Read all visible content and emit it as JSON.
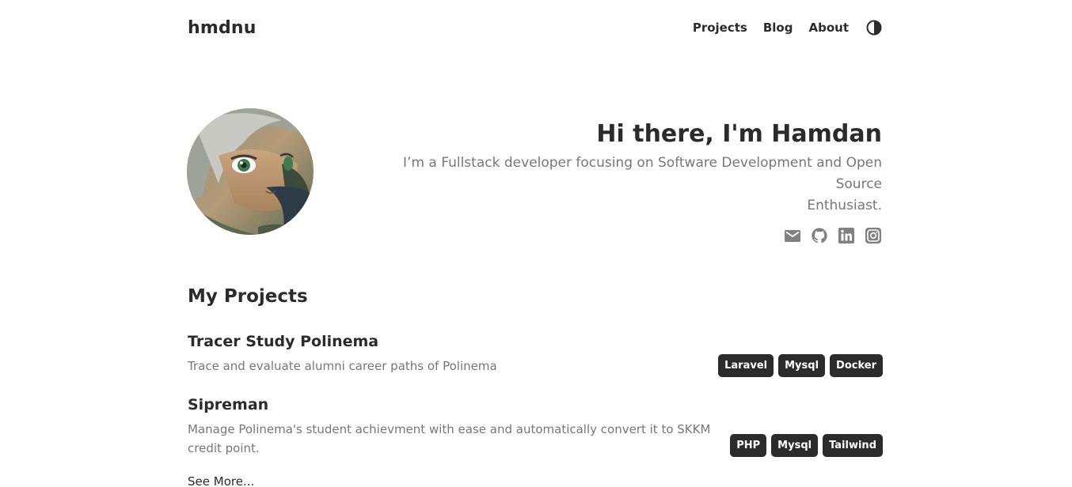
{
  "header": {
    "brand": "hmdnu",
    "nav": [
      "Projects",
      "Blog",
      "About"
    ],
    "theme_toggle_icon": "contrast-icon"
  },
  "hero": {
    "title": "Hi there, I'm Hamdan",
    "subtitle_line1": "I’m a Fullstack developer focusing on Software Development and Open Source",
    "subtitle_line2": "Enthusiast.",
    "socials": [
      "mail-icon",
      "github-icon",
      "linkedin-icon",
      "instagram-icon"
    ]
  },
  "projects": {
    "title": "My Projects",
    "items": [
      {
        "name": "Tracer Study Polinema",
        "description": "Trace and evaluate alumni career paths of Polinema",
        "tags": [
          "Laravel",
          "Mysql",
          "Docker"
        ]
      },
      {
        "name": "Sipreman",
        "description": "Manage Polinema's student achievment with ease and automatically convert it to SKKM credit point.",
        "tags": [
          "PHP",
          "Mysql",
          "Tailwind"
        ]
      }
    ],
    "see_more": "See More..."
  },
  "colors": {
    "text": "#2b2b2b",
    "muted": "#777777",
    "icon": "#808080",
    "tag_bg": "#2b2b2b"
  }
}
